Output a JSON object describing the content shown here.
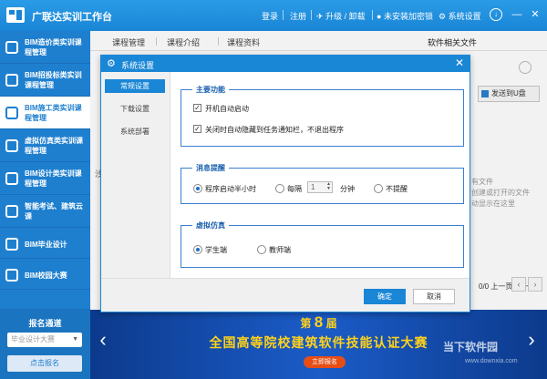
{
  "window": {
    "title": "广联达实训工作台",
    "login": "登录",
    "register": "注册",
    "upgrade": "升级 / 卸载",
    "lock": "未安装加密锁",
    "settings": "系统设置",
    "minimize": "—",
    "close": "✕"
  },
  "sidebar": {
    "items": [
      {
        "label": "BIM造价类实训课程管理"
      },
      {
        "label": "BIM招投标类实训课程管理"
      },
      {
        "label": "BIM施工类实训课程管理"
      },
      {
        "label": "虚拟仿真类实训课程管理"
      },
      {
        "label": "BIM设计类实训课程管理"
      },
      {
        "label": "智能考试、建筑云课"
      },
      {
        "label": "BIM毕业设计"
      },
      {
        "label": "BIM校园大赛"
      }
    ],
    "enroll": {
      "title": "报名通道",
      "select_value": "毕业设计大赛",
      "button": "点击报名"
    }
  },
  "main": {
    "tabs": [
      {
        "label": "课程管理"
      },
      {
        "label": "课程介绍"
      },
      {
        "label": "课程资料"
      }
    ],
    "software_files": "软件相关文件",
    "send_usb": "发送到U盘",
    "edge_char": "沙",
    "bg_lines": [
      "有文件",
      "创建或打开的文件",
      "动显示在这里"
    ],
    "pager": "0/0 上一页 下一页"
  },
  "banner": {
    "session_prefix": "第",
    "session_num": "8",
    "session_suffix": "届",
    "title": "全国高等院校建筑软件技能认证大赛",
    "button": "立即报名",
    "watermark": "当下软件园",
    "watermark_sub": "www.downxia.com"
  },
  "dialog": {
    "title": "系统设置",
    "nav": [
      {
        "label": "常规设置"
      },
      {
        "label": "下载设置"
      },
      {
        "label": "系统部署"
      }
    ],
    "main_func": {
      "title": "主要功能",
      "opt1": "开机自动启动",
      "opt1_checked": true,
      "opt2": "关闭时自动隐藏到任务通知栏，不退出程序",
      "opt2_checked": true
    },
    "reminder": {
      "title": "消息提醒",
      "opt1": "程序启动半小时",
      "opt2": "每隔",
      "interval_value": "1",
      "unit": "分钟",
      "opt3": "不提醒",
      "selected": "opt1"
    },
    "sim": {
      "title": "虚拟仿真",
      "opt1": "学生端",
      "opt2": "教师端",
      "selected": "opt1"
    },
    "ok": "确定",
    "cancel": "取消"
  },
  "colors": {
    "brand": "#1a86d6",
    "sidebar": "#1e7fcf",
    "banner_text": "#ffd21a"
  }
}
